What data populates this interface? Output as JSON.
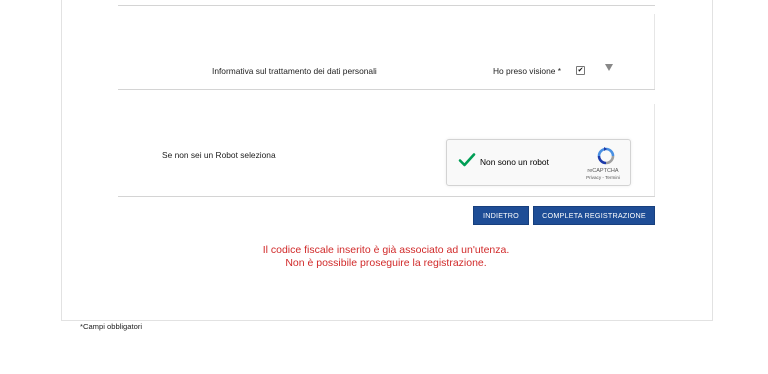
{
  "form": {
    "privacy_label": "Informativa sul trattamento dei dati personali",
    "privacy_ack_label": "Ho preso visione *",
    "privacy_checkbox_mark": "✔",
    "robot_label": "Se non sei un Robot seleziona",
    "recaptcha": {
      "label": "Non sono un robot",
      "brand": "reCAPTCHA",
      "links": "Privacy - Termini"
    }
  },
  "actions": {
    "back_label": "INDIETRO",
    "complete_label": "COMPLETA REGISTRAZIONE"
  },
  "error": {
    "line1": "Il codice fiscale inserito è già associato ad un'utenza.",
    "line2": "Non è possibile proseguire la registrazione."
  },
  "footnote": "*Campi obbligatori",
  "colors": {
    "button": "#1e4d96",
    "error": "#d12a2a",
    "recaptcha_check": "#009e55"
  }
}
